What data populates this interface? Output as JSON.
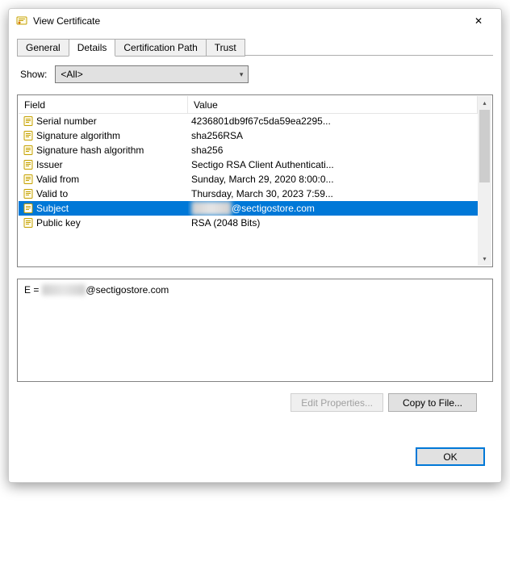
{
  "window": {
    "title": "View Certificate",
    "close": "✕"
  },
  "tabs": [
    {
      "label": "General"
    },
    {
      "label": "Details",
      "active": true
    },
    {
      "label": "Certification Path"
    },
    {
      "label": "Trust"
    }
  ],
  "show": {
    "label": "Show:",
    "value": "<All>"
  },
  "list": {
    "headers": {
      "field": "Field",
      "value": "Value"
    },
    "rows": [
      {
        "field": "Serial number",
        "value": "4236801db9f67c5da59ea2295..."
      },
      {
        "field": "Signature algorithm",
        "value": "sha256RSA"
      },
      {
        "field": "Signature hash algorithm",
        "value": "sha256"
      },
      {
        "field": "Issuer",
        "value": "Sectigo RSA Client Authenticati..."
      },
      {
        "field": "Valid from",
        "value": "Sunday, March 29, 2020 8:00:0..."
      },
      {
        "field": "Valid to",
        "value": "Thursday, March 30, 2023 7:59..."
      },
      {
        "field": "Subject",
        "value": "@sectigostore.com",
        "selected": true,
        "valueBlurPrefix": true
      },
      {
        "field": "Public key",
        "value": "RSA (2048 Bits)"
      }
    ]
  },
  "details": {
    "prefix": "E = ",
    "blurred": "redacted",
    "suffix": "@sectigostore.com"
  },
  "buttons": {
    "edit": "Edit Properties...",
    "copy": "Copy to File..."
  },
  "footer": {
    "ok": "OK"
  }
}
